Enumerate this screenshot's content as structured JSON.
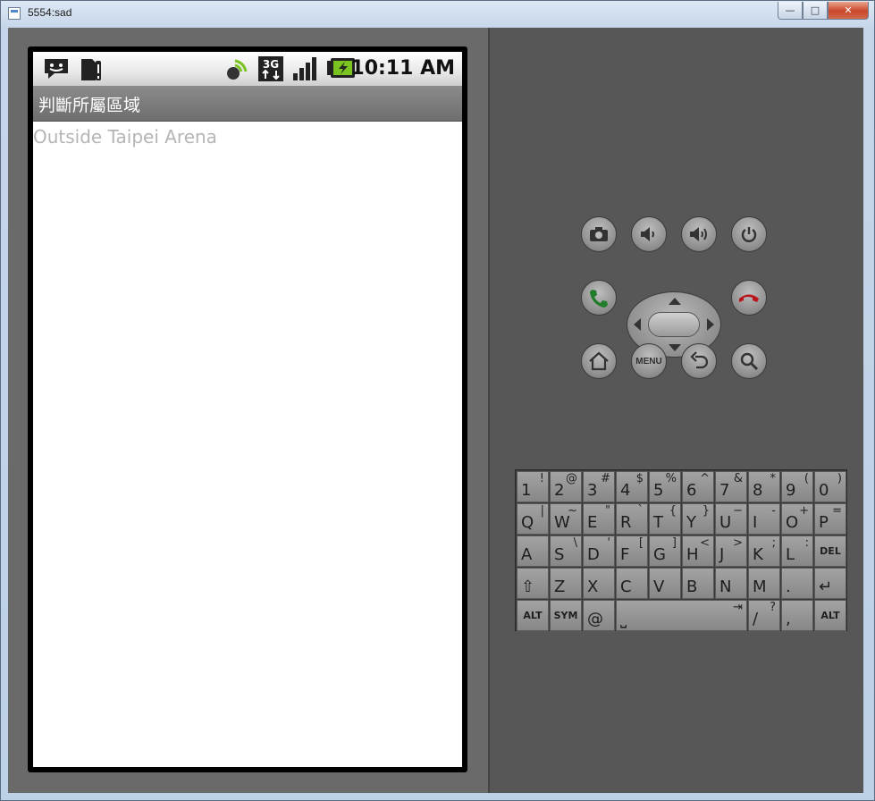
{
  "window": {
    "title": "5554:sad",
    "controls": {
      "minimize": "—",
      "maximize": "□",
      "close": "✕"
    }
  },
  "phone": {
    "status_bar": {
      "icons": [
        "sms-icon",
        "sd-card-warning-icon",
        "gps-icon",
        "3g-data-icon",
        "signal-icon",
        "battery-charging-icon"
      ],
      "network_label": "3G",
      "time": "10:11 AM"
    },
    "app": {
      "title": "判斷所屬區域",
      "content_text": "Outside Taipei Arena"
    }
  },
  "hardware_buttons": {
    "row1": [
      "camera-icon",
      "volume-down-icon",
      "volume-up-icon",
      "power-icon"
    ],
    "row2": [
      "call-icon",
      "dpad",
      "end-call-icon"
    ],
    "row3": [
      "home-icon",
      "menu",
      "back-icon",
      "search-icon"
    ],
    "menu_label": "MENU"
  },
  "keyboard": {
    "row1": [
      [
        "1",
        "!"
      ],
      [
        "2",
        "@"
      ],
      [
        "3",
        "#"
      ],
      [
        "4",
        "$"
      ],
      [
        "5",
        "%"
      ],
      [
        "6",
        "^"
      ],
      [
        "7",
        "&"
      ],
      [
        "8",
        "*"
      ],
      [
        "9",
        "("
      ],
      [
        "0",
        ")"
      ]
    ],
    "row2": [
      [
        "Q",
        "|"
      ],
      [
        "W",
        "~"
      ],
      [
        "E",
        "\""
      ],
      [
        "R",
        "`"
      ],
      [
        "T",
        "{"
      ],
      [
        "Y",
        "}"
      ],
      [
        "U",
        "−"
      ],
      [
        "I",
        "-"
      ],
      [
        "O",
        "+"
      ],
      [
        "P",
        "="
      ]
    ],
    "row3": [
      [
        "A",
        ""
      ],
      [
        "S",
        "\\"
      ],
      [
        "D",
        "'"
      ],
      [
        "F",
        "["
      ],
      [
        "G",
        "]"
      ],
      [
        "H",
        "<"
      ],
      [
        "J",
        ">"
      ],
      [
        "K",
        ";"
      ],
      [
        "L",
        ":"
      ]
    ],
    "row3_del": "DEL",
    "row4": [
      [
        "Z",
        ""
      ],
      [
        "X",
        ""
      ],
      [
        "C",
        ""
      ],
      [
        "V",
        ""
      ],
      [
        "B",
        ""
      ],
      [
        "N",
        ""
      ],
      [
        "M",
        ""
      ],
      [
        ".",
        ""
      ]
    ],
    "row5": {
      "alt_left": "ALT",
      "sym": "SYM",
      "at": "@",
      "slash": "/",
      "slash_alt": "?",
      "comma": ",",
      "alt_right": "ALT"
    }
  }
}
